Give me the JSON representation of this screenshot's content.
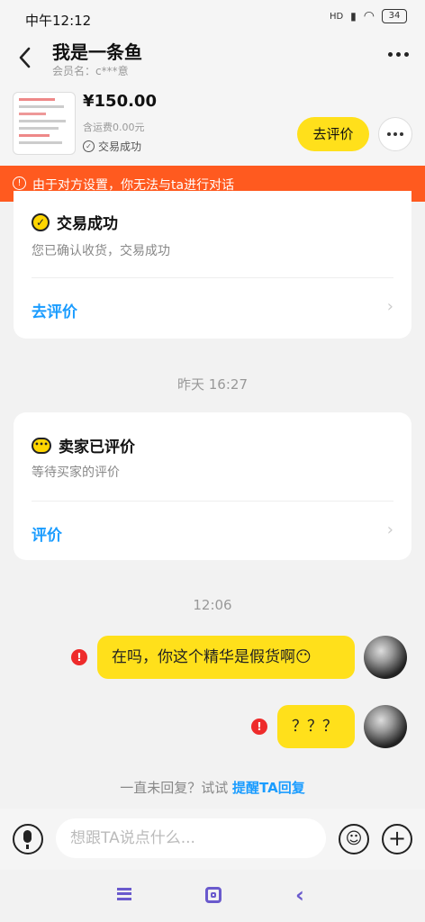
{
  "status": {
    "time": "中午12:12",
    "network": "HD",
    "battery": "34"
  },
  "header": {
    "title": "我是一条鱼",
    "subtitle": "会员名：c***意"
  },
  "product": {
    "price": "¥150.00",
    "shipping": "含运费0.00元",
    "status": "交易成功",
    "review_button": "去评价"
  },
  "notice": {
    "text": "由于对方设置，你无法与ta进行对话"
  },
  "card1": {
    "title": "交易成功",
    "desc": "您已确认收货，交易成功",
    "link": "去评价"
  },
  "timestamp1": "昨天 16:27",
  "card2": {
    "title": "卖家已评价",
    "desc": "等待买家的评价",
    "link": "评价"
  },
  "timestamp2": "12:06",
  "messages": [
    {
      "text": "在吗，你这个精华是假货啊😶"
    },
    {
      "text": "？？？"
    }
  ],
  "hint": {
    "prefix": "一直未回复？试试 ",
    "action": "提醒TA回复"
  },
  "input": {
    "placeholder": "想跟TA说点什么..."
  },
  "colors": {
    "accent_yellow": "#ffe01b",
    "notice_orange": "#ff5a1f",
    "link_blue": "#1a9cff",
    "error_red": "#ee2b2b"
  }
}
